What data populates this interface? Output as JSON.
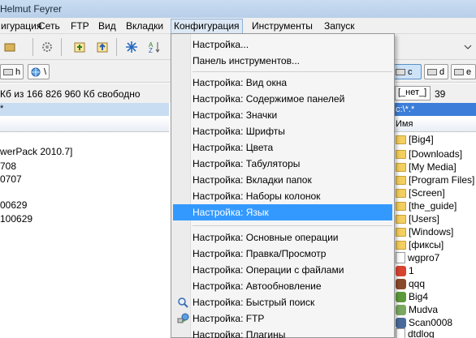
{
  "window": {
    "title": "Helmut Feyrer"
  },
  "menubar": {
    "items": [
      {
        "label": "игурация"
      },
      {
        "label": "Сеть"
      },
      {
        "label": "FTP"
      },
      {
        "label": "Вид"
      },
      {
        "label": "Вкладки"
      },
      {
        "label": "Конфигурация"
      },
      {
        "label": "Инструменты"
      },
      {
        "label": "Запуск"
      }
    ]
  },
  "drives": {
    "left": {
      "label": "h",
      "label2": "\\"
    },
    "right": [
      {
        "label": "c"
      },
      {
        "label": "d"
      },
      {
        "label": "e"
      }
    ]
  },
  "left_panel": {
    "free_space": "Кб из 166 826 960 Кб свободно",
    "path_star": "*",
    "rows": [
      "werPack 2010.7]",
      "708",
      "0707",
      "00629",
      "100629"
    ]
  },
  "right_panel": {
    "drive_combo": "[_нет_]",
    "free_fragment": "39",
    "path": "c:\\*.*",
    "column_name": "Имя",
    "files": [
      {
        "name": "[Big4]",
        "icon": "folder-icon"
      },
      {
        "name": "[Downloads]",
        "icon": "folder-icon"
      },
      {
        "name": "[My Media]",
        "icon": "folder-icon"
      },
      {
        "name": "[Program Files]",
        "icon": "folder-icon"
      },
      {
        "name": "[Screen]",
        "icon": "folder-icon"
      },
      {
        "name": "[the_guide]",
        "icon": "folder-icon"
      },
      {
        "name": "[Users]",
        "icon": "folder-icon"
      },
      {
        "name": "[Windows]",
        "icon": "folder-icon"
      },
      {
        "name": "[фиксы]",
        "icon": "folder-icon"
      },
      {
        "name": "wgpro7",
        "icon": "file-icon"
      },
      {
        "name": "1",
        "icon": "app-icon"
      },
      {
        "name": "qqq",
        "icon": "app-icon"
      },
      {
        "name": "Big4",
        "icon": "app-icon"
      },
      {
        "name": "Mudva",
        "icon": "app-icon"
      },
      {
        "name": "Scan0008",
        "icon": "app-icon"
      },
      {
        "name": "dtdlog",
        "icon": "file-icon"
      }
    ]
  },
  "config_menu": {
    "items": [
      {
        "label": "Настройка..."
      },
      {
        "label": "Панель инструментов..."
      },
      {
        "label": "Настройка: Вид окна"
      },
      {
        "label": "Настройка: Содержимое панелей"
      },
      {
        "label": "Настройка:  Значки"
      },
      {
        "label": "Настройка:  Шрифты"
      },
      {
        "label": "Настройка:  Цвета"
      },
      {
        "label": "Настройка:  Табуляторы"
      },
      {
        "label": "Настройка:  Вкладки папок"
      },
      {
        "label": "Настройка:  Наборы колонок"
      },
      {
        "label": "Настройка:  Язык"
      },
      {
        "label": "Настройка: Основные операции"
      },
      {
        "label": "Настройка:  Правка/Просмотр"
      },
      {
        "label": "Настройка:  Операции с файлами"
      },
      {
        "label": "Настройка:  Автообновление"
      },
      {
        "label": "Настройка:  Быстрый поиск"
      },
      {
        "label": "Настройка:  FTP"
      },
      {
        "label": "Настройка:  Плагины"
      }
    ],
    "highlighted": "Настройка:  Язык",
    "colors": {
      "highlight": "#3399ff",
      "menu_bg": "#f5f5f5"
    }
  }
}
